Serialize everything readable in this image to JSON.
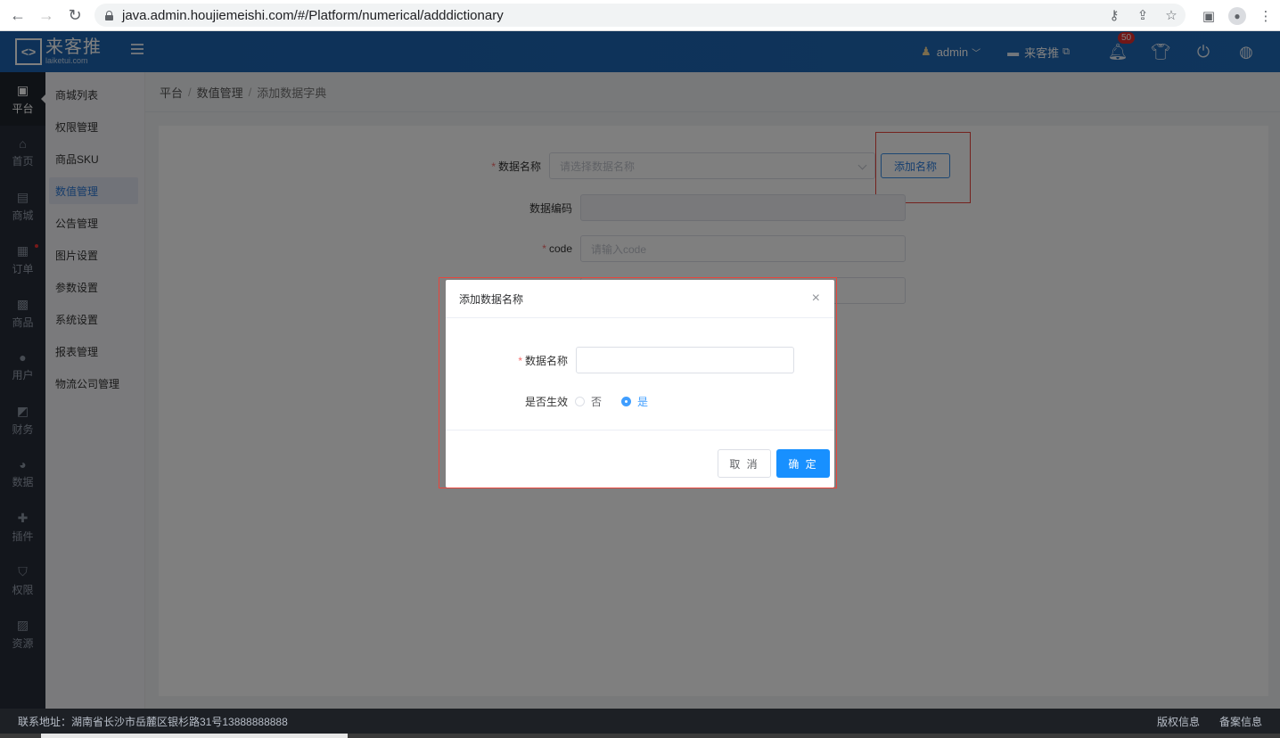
{
  "browser": {
    "url": "java.admin.houjiemeishi.com/#/Platform/numerical/adddictionary"
  },
  "header": {
    "logo_name": "来客推",
    "logo_url": "laiketui.com",
    "user": "admin",
    "store": "来客推",
    "notification_count": "50"
  },
  "left_nav": [
    {
      "label": "平台",
      "icon": "platform-icon"
    },
    {
      "label": "首页",
      "icon": "home-icon"
    },
    {
      "label": "商城",
      "icon": "mall-icon"
    },
    {
      "label": "订单",
      "icon": "order-icon"
    },
    {
      "label": "商品",
      "icon": "goods-icon"
    },
    {
      "label": "用户",
      "icon": "user-icon"
    },
    {
      "label": "财务",
      "icon": "wallet-icon"
    },
    {
      "label": "数据",
      "icon": "pie-chart-icon"
    },
    {
      "label": "插件",
      "icon": "puzzle-icon"
    },
    {
      "label": "权限",
      "icon": "shield-icon"
    },
    {
      "label": "资源",
      "icon": "image-icon"
    }
  ],
  "sub_nav": [
    "商城列表",
    "权限管理",
    "商品SKU",
    "数值管理",
    "公告管理",
    "图片设置",
    "参数设置",
    "系统设置",
    "报表管理",
    "物流公司管理"
  ],
  "breadcrumb": {
    "level1": "平台",
    "level2": "数值管理",
    "level3": "添加数据字典"
  },
  "form": {
    "name_label": "数据名称",
    "name_placeholder": "请选择数据名称",
    "add_name_button": "添加名称",
    "code_no_label": "数据编码",
    "code_label": "code",
    "code_placeholder": "请输入code"
  },
  "dialog": {
    "title": "添加数据名称",
    "name_label": "数据名称",
    "name_value": "",
    "active_label": "是否生效",
    "option_no": "否",
    "option_yes": "是",
    "selected": "是",
    "cancel_label": "取 消",
    "ok_label": "确 定"
  },
  "footer": {
    "address": "联系地址：湖南省长沙市岳麓区银杉路31号13888888888",
    "copyright": "版权信息",
    "record": "备案信息"
  },
  "colors": {
    "header_blue": "#1e63b0",
    "primary": "#1890ff",
    "required": "#f56c6c",
    "highlight_red": "#e8453c"
  }
}
